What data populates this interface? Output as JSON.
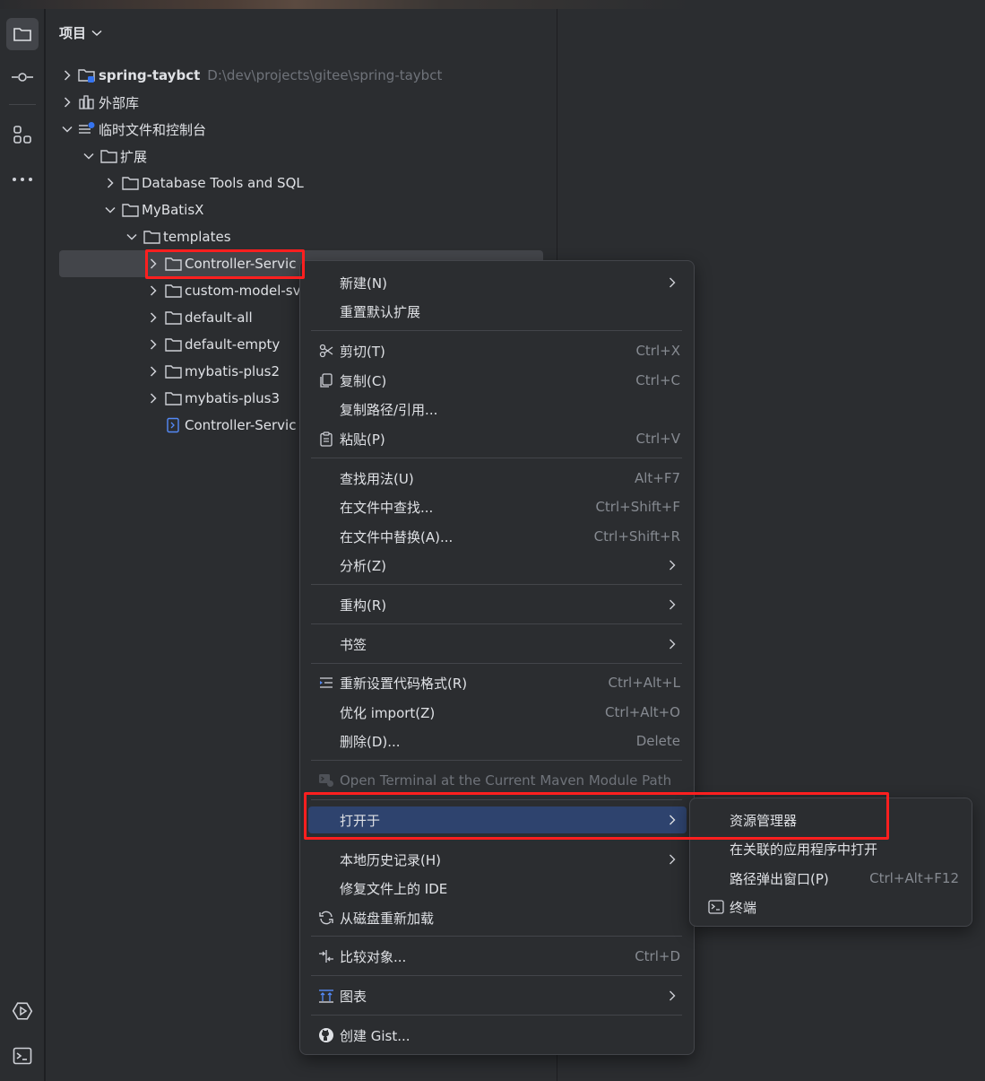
{
  "panel": {
    "title": "项目"
  },
  "tree": [
    {
      "label": "spring-taybct",
      "path": "D:\\dev\\projects\\gitee\\spring-taybct",
      "expanded": false,
      "icon": "module-folder-icon"
    },
    {
      "label": "外部库",
      "expanded": false,
      "icon": "library-icon"
    },
    {
      "label": "临时文件和控制台",
      "expanded": true,
      "icon": "scratches-icon"
    },
    {
      "label": "扩展",
      "expanded": true,
      "icon": "folder-icon"
    },
    {
      "label": "Database Tools and SQL",
      "expanded": false,
      "icon": "folder-icon"
    },
    {
      "label": "MyBatisX",
      "expanded": true,
      "icon": "folder-icon"
    },
    {
      "label": "templates",
      "expanded": true,
      "icon": "folder-icon"
    },
    {
      "label": "Controller-Servic",
      "expanded": false,
      "icon": "folder-icon",
      "selected": true
    },
    {
      "label": "custom-model-sv",
      "expanded": false,
      "icon": "folder-icon"
    },
    {
      "label": "default-all",
      "expanded": false,
      "icon": "folder-icon"
    },
    {
      "label": "default-empty",
      "expanded": false,
      "icon": "folder-icon"
    },
    {
      "label": "mybatis-plus2",
      "expanded": false,
      "icon": "folder-icon"
    },
    {
      "label": "mybatis-plus3",
      "expanded": false,
      "icon": "folder-icon"
    },
    {
      "label": "Controller-Servic",
      "icon": "xml-file-icon"
    }
  ],
  "context_menu": {
    "new": "新建(N)",
    "reset_extensions": "重置默认扩展",
    "cut": {
      "label": "剪切(T)",
      "shortcut": "Ctrl+X"
    },
    "copy": {
      "label": "复制(C)",
      "shortcut": "Ctrl+C"
    },
    "copy_path": "复制路径/引用...",
    "paste": {
      "label": "粘贴(P)",
      "shortcut": "Ctrl+V"
    },
    "find_usages": {
      "label": "查找用法(U)",
      "shortcut": "Alt+F7"
    },
    "find_in_files": {
      "label": "在文件中查找...",
      "shortcut": "Ctrl+Shift+F"
    },
    "replace_in_files": {
      "label": "在文件中替换(A)...",
      "shortcut": "Ctrl+Shift+R"
    },
    "analyze": "分析(Z)",
    "refactor": "重构(R)",
    "bookmarks": "书签",
    "reformat": {
      "label": "重新设置代码格式(R)",
      "shortcut": "Ctrl+Alt+L"
    },
    "optimize_imports": {
      "label": "优化 import(Z)",
      "shortcut": "Ctrl+Alt+O"
    },
    "delete": {
      "label": "删除(D)...",
      "shortcut": "Delete"
    },
    "open_terminal_maven": "Open Terminal at the Current Maven Module Path",
    "open_in": "打开于",
    "local_history": "本地历史记录(H)",
    "repair_ide": "修复文件上的 IDE",
    "reload_from_disk": "从磁盘重新加载",
    "compare_with": {
      "label": "比较对象...",
      "shortcut": "Ctrl+D"
    },
    "diagrams": "图表",
    "create_gist": "创建 Gist..."
  },
  "submenu_open_in": {
    "explorer": "资源管理器",
    "associated_app": "在关联的应用程序中打开",
    "path_popup": {
      "label": "路径弹出窗口(P)",
      "shortcut": "Ctrl+Alt+F12"
    },
    "terminal": "终端"
  },
  "colors": {
    "background": "#1e1f22",
    "panel": "#2b2d30",
    "selection": "#43454a",
    "menu_active": "#2e436e",
    "highlight_box": "#ff1f1f"
  }
}
